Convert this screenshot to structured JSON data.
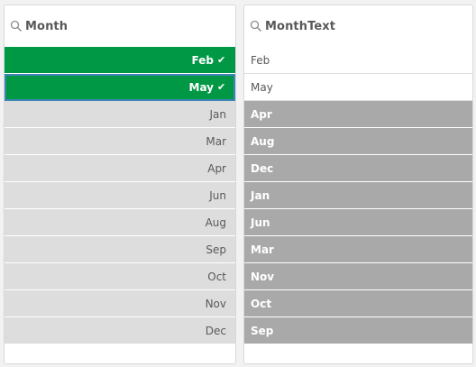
{
  "month_pane": {
    "title": "Month",
    "selected": [
      {
        "label": "Feb",
        "check": "✔"
      },
      {
        "label": "May",
        "check": "✔"
      }
    ],
    "alternative": [
      "Jan",
      "Mar",
      "Apr",
      "Jun",
      "Aug",
      "Sep",
      "Oct",
      "Nov",
      "Dec"
    ]
  },
  "monthtext_pane": {
    "title": "MonthText",
    "possible": [
      "Feb",
      "May"
    ],
    "excluded": [
      "Apr",
      "Aug",
      "Dec",
      "Jan",
      "Jun",
      "Mar",
      "Nov",
      "Oct",
      "Sep"
    ]
  },
  "colors": {
    "selected": "#009845",
    "alternative": "#dddddd",
    "excluded": "#a9a9a9",
    "focus_outline": "#3b84b5"
  },
  "icons": {
    "search": "search-icon",
    "check": "check-icon"
  }
}
